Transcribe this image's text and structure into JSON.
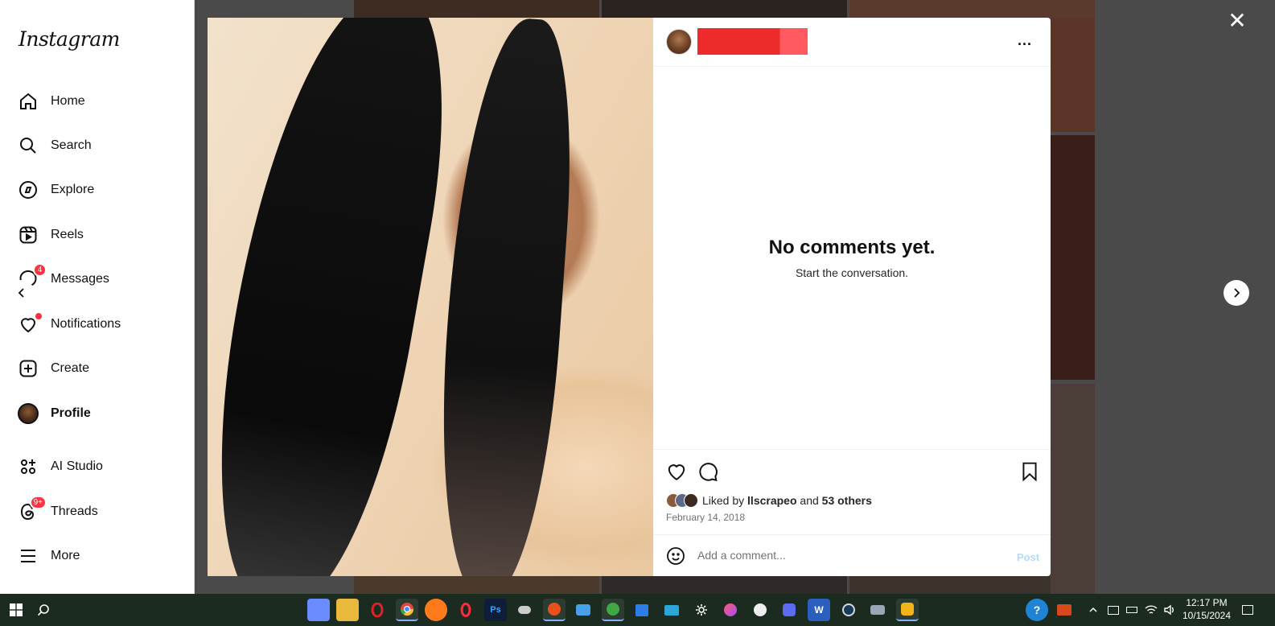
{
  "app": {
    "logo": "Instagram"
  },
  "sidebar": {
    "items": [
      {
        "label": "Home",
        "icon": "home-icon"
      },
      {
        "label": "Search",
        "icon": "search-icon"
      },
      {
        "label": "Explore",
        "icon": "compass-icon"
      },
      {
        "label": "Reels",
        "icon": "reels-icon"
      },
      {
        "label": "Messages",
        "icon": "messenger-icon",
        "badge": "4"
      },
      {
        "label": "Notifications",
        "icon": "heart-icon"
      },
      {
        "label": "Create",
        "icon": "plus-square-icon"
      },
      {
        "label": "Profile",
        "icon": "avatar"
      },
      {
        "label": "AI Studio",
        "icon": "ai-studio-icon"
      },
      {
        "label": "Threads",
        "icon": "threads-icon",
        "badge": "9+"
      },
      {
        "label": "More",
        "icon": "menu-icon"
      }
    ]
  },
  "post": {
    "comments": {
      "empty_title": "No comments yet.",
      "empty_sub": "Start the conversation."
    },
    "likes": {
      "prefix": "Liked by",
      "user": "llscrapeo",
      "joiner": "and",
      "others": "53 others"
    },
    "date": "February 14, 2018",
    "comment_box": {
      "placeholder": "Add a comment...",
      "post_label": "Post"
    },
    "more_label": "..."
  },
  "dialog": {
    "close_label": "✕"
  },
  "taskbar": {
    "time": "12:17 PM",
    "date": "10/15/2024"
  },
  "colors": {
    "accent": "#0095f6",
    "badge": "#ff3040",
    "redaction": "#ee2b2b",
    "taskbar": "#1c2b1f"
  }
}
